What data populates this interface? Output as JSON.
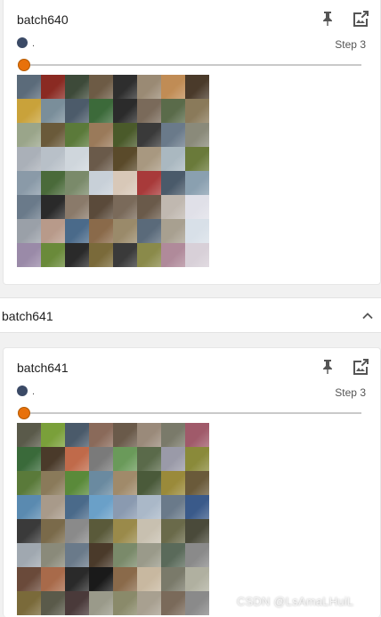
{
  "colors": {
    "run_dot": "#3b4a66",
    "slider_thumb": "#e8710a",
    "icon": "#555555"
  },
  "cards": [
    {
      "title": "batch640",
      "run_label": ".",
      "step": "Step 3",
      "slider_fraction": 0.0
    },
    {
      "title": "batch641",
      "run_label": ".",
      "step": "Step 3",
      "slider_fraction": 0.0
    }
  ],
  "section": {
    "title": "batch641"
  },
  "watermark": "CSDN @LsAmaLHuiL",
  "icons": [
    "pin-icon",
    "expand-image-icon",
    "chevron-up-icon"
  ],
  "image_grid": {
    "rows": 8,
    "cols": 8,
    "palettes": [
      [
        "#5b6b7a",
        "#8a2a22",
        "#3d4a39",
        "#6d5b45",
        "#2e2e2e",
        "#9a8a74",
        "#c08c55",
        "#4a3a2a",
        "#c9a23a",
        "#7a8e9a",
        "#4c5b6a",
        "#3c6a3a",
        "#2b2b2b",
        "#7a6a5a",
        "#5a6b4a",
        "#8a7a5a",
        "#9aa58a",
        "#6a5a3a",
        "#5b7a3a",
        "#9a7a5a",
        "#4a5a2a",
        "#3a3a3a",
        "#6a7a8a",
        "#8a8a7a",
        "#aab0b8",
        "#b8c0c8",
        "#cfd6dc",
        "#6a5a4a",
        "#5a4a2a",
        "#a89880",
        "#aab8c0",
        "#6a7a3a",
        "#8a9aa8",
        "#4a6a3a",
        "#7a8a6a",
        "#c8d0d8",
        "#d8c8b8",
        "#a83a3a",
        "#4a5a6a",
        "#8aa0b0",
        "#6a7a8a",
        "#2a2a2a",
        "#8a7a6a",
        "#5a4a3a",
        "#7a6a5a",
        "#6a5a4a",
        "#c0b8b0",
        "#e0e0e8",
        "#9aa0a8",
        "#b89a8a",
        "#4a6a8a",
        "#8a6a4a",
        "#9a8a6a",
        "#5a6a7a",
        "#a8a090",
        "#d8e0e8",
        "#9a8aa8",
        "#6a8a3a",
        "#2a2a2a",
        "#7a6a3a",
        "#3a3a3a",
        "#8a8a4a",
        "#b08a9a",
        "#d8d0d8"
      ],
      [
        "#5a5a4a",
        "#7aa03a",
        "#4a5a6a",
        "#8a6a5a",
        "#6a5a4a",
        "#9a8a7a",
        "#7a7a6a",
        "#a05a6a",
        "#3a6a3a",
        "#4a3a2a",
        "#c06a4a",
        "#7a7a7a",
        "#6a9a5a",
        "#5a6a4a",
        "#9a9aa8",
        "#8a8a3a",
        "#5a7a3a",
        "#8a7a5a",
        "#5a8a3a",
        "#6a8aa0",
        "#a08a6a",
        "#4a5a3a",
        "#9a8a3a",
        "#6a5a3a",
        "#5a8ab0",
        "#a89a8a",
        "#4a6a8a",
        "#6aa0c8",
        "#8a9ab0",
        "#aab8c8",
        "#6a7a8a",
        "#3a5a8a",
        "#3a3a3a",
        "#7a6a4a",
        "#8a8a8a",
        "#5a5a3a",
        "#9a8a4a",
        "#c8c0b0",
        "#6a6a4a",
        "#4a4a3a",
        "#a0a8b0",
        "#8a8a7a",
        "#6a7a8a",
        "#4a3a2a",
        "#7a8a6a",
        "#9a9a8a",
        "#5a6a5a",
        "#8a8a8a",
        "#6a4a3a",
        "#a86a4a",
        "#2a2a2a",
        "#1a1a1a",
        "#8a6a4a",
        "#c8b8a0",
        "#7a7a6a",
        "#b0b0a0",
        "#7a6a3a",
        "#5a5a4a",
        "#4a3a3a",
        "#9a9a8a",
        "#8a8a6a",
        "#a8a090",
        "#7a6a5a",
        "#8a8a8a"
      ]
    ]
  }
}
